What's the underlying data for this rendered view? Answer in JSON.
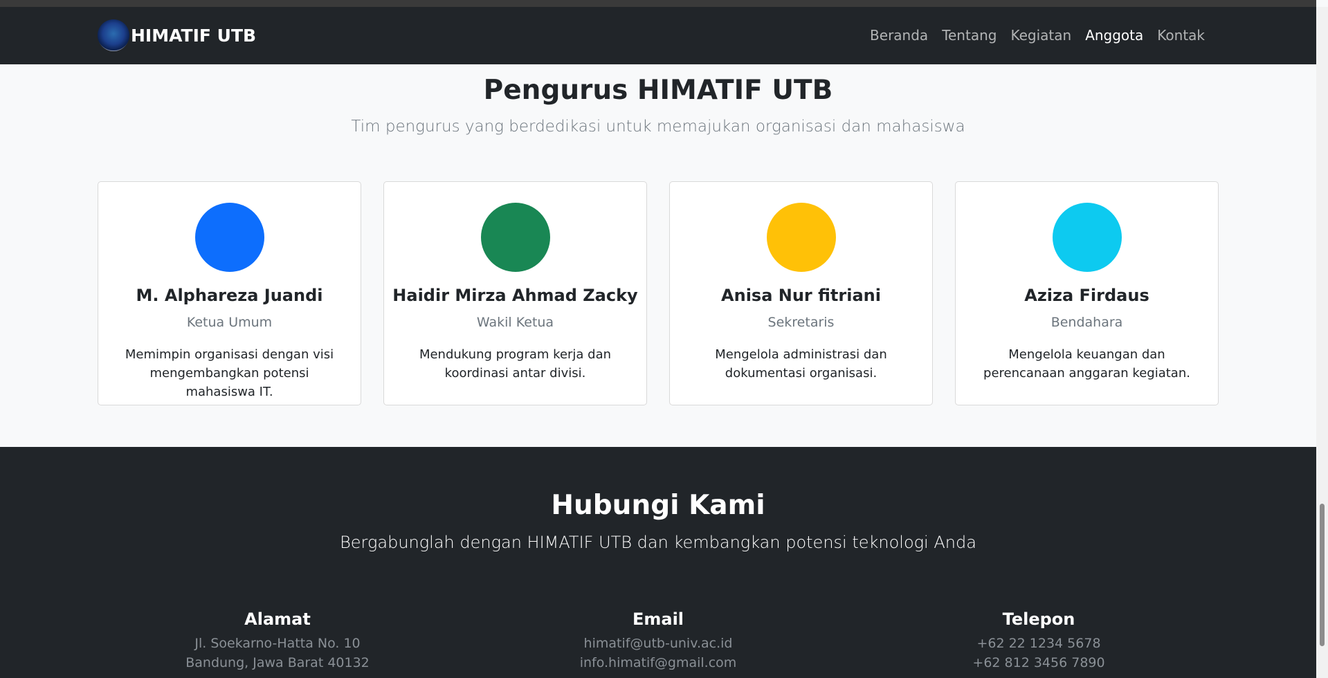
{
  "navbar": {
    "brand": "HIMATIF UTB",
    "links": [
      "Beranda",
      "Tentang",
      "Kegiatan",
      "Anggota",
      "Kontak"
    ],
    "active_link": "Anggota"
  },
  "pengurus": {
    "title": "Pengurus HIMATIF UTB",
    "subtitle": "Tim pengurus yang berdedikasi untuk memajukan organisasi dan mahasiswa",
    "members": [
      {
        "name": "M. Alphareza Juandi",
        "role": "Ketua Umum",
        "desc": "Memimpin organisasi dengan visi mengembangkan potensi mahasiswa IT.",
        "color": "#0d6efd"
      },
      {
        "name": "Haidir Mirza Ahmad Zacky",
        "role": "Wakil Ketua",
        "desc": "Mendukung program kerja dan koordinasi antar divisi.",
        "color": "#198754"
      },
      {
        "name": "Anisa Nur fitriani",
        "role": "Sekretaris",
        "desc": "Mengelola administrasi dan dokumentasi organisasi.",
        "color": "#ffc107"
      },
      {
        "name": "Aziza Firdaus",
        "role": "Bendahara",
        "desc": "Mengelola keuangan dan perencanaan anggaran kegiatan.",
        "color": "#0dcaf0"
      }
    ]
  },
  "contact": {
    "title": "Hubungi Kami",
    "subtitle": "Bergabunglah dengan HIMATIF UTB dan kembangkan potensi teknologi Anda",
    "columns": [
      {
        "heading": "Alamat",
        "lines": [
          "Jl. Soekarno-Hatta No. 10",
          "Bandung, Jawa Barat 40132"
        ]
      },
      {
        "heading": "Email",
        "lines": [
          "himatif@utb-univ.ac.id",
          "info.himatif@gmail.com"
        ]
      },
      {
        "heading": "Telepon",
        "lines": [
          "+62 22 1234 5678",
          "+62 812 3456 7890"
        ]
      }
    ]
  }
}
